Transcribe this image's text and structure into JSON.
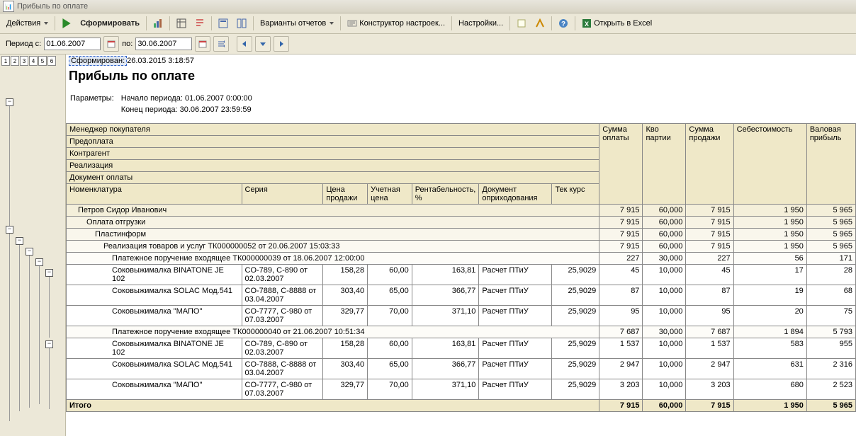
{
  "window_title": "Прибыль по оплате",
  "toolbar": {
    "actions": "Действия",
    "form": "Сформировать",
    "variants": "Варианты отчетов",
    "constructor": "Конструктор настроек...",
    "settings": "Настройки...",
    "open_excel": "Открыть в Excel"
  },
  "period": {
    "label_from": "Период с:",
    "from": "01.06.2007",
    "label_to": "по:",
    "to": "30.06.2007"
  },
  "meta": {
    "formed_prefix": "Сформирован:",
    "formed_at": "26.03.2015 3:18:57",
    "title": "Прибыль по оплате",
    "params_label": "Параметры:",
    "period_start": "Начало периода: 01.06.2007 0:00:00",
    "period_end": "Конец периода: 30.06.2007 23:59:59"
  },
  "headers": {
    "g0": "Менеджер покупателя",
    "g1": "Предоплата",
    "g2": "Контрагент",
    "g3": "Реализация",
    "g4": "Документ оплаты",
    "nomen": "Номенклатура",
    "series": "Серия",
    "price_sale": "Цена продажи",
    "price_acc": "Учетная цена",
    "profitab": "Рентабельность, %",
    "doc_in": "Документ оприходования",
    "rate": "Тек курс",
    "sum_pay": "Сумма оплаты",
    "qty": "Кво партии",
    "sum_sale": "Сумма продажи",
    "cost": "Себестоимость",
    "gross": "Валовая прибыль"
  },
  "groups": [
    {
      "lvl": 0,
      "label": "Петров Сидор Иванович",
      "s": "7 915",
      "q": "60,000",
      "ss": "7 915",
      "c": "1 950",
      "g": "5 965"
    },
    {
      "lvl": 1,
      "label": "Оплата отгрузки",
      "s": "7 915",
      "q": "60,000",
      "ss": "7 915",
      "c": "1 950",
      "g": "5 965"
    },
    {
      "lvl": 2,
      "label": "Пластинформ",
      "s": "7 915",
      "q": "60,000",
      "ss": "7 915",
      "c": "1 950",
      "g": "5 965"
    },
    {
      "lvl": 3,
      "label": "Реализация товаров и услуг ТК000000052 от 20.06.2007 15:03:33",
      "s": "7 915",
      "q": "60,000",
      "ss": "7 915",
      "c": "1 950",
      "g": "5 965"
    },
    {
      "lvl": 4,
      "label": "Платежное поручение входящее ТК000000039 от 18.06.2007 12:00:00",
      "s": "227",
      "q": "30,000",
      "ss": "227",
      "c": "56",
      "g": "171"
    }
  ],
  "rows1": [
    {
      "nomen": "Соковыжималка  BINATONE JE 102",
      "ser": "CO-789, C-890 от 02.03.2007",
      "ps": "158,28",
      "pa": "60,00",
      "r": "163,81",
      "doc": "Расчет ПТиУ",
      "rate": "25,9029",
      "s": "45",
      "q": "10,000",
      "ss": "45",
      "c": "17",
      "g": "28"
    },
    {
      "nomen": "Соковыжималка  SOLAC  Мод.541",
      "ser": "CO-7888, C-8888 от 03.04.2007",
      "ps": "303,40",
      "pa": "65,00",
      "r": "366,77",
      "doc": "Расчет ПТиУ",
      "rate": "25,9029",
      "s": "87",
      "q": "10,000",
      "ss": "87",
      "c": "19",
      "g": "68"
    },
    {
      "nomen": "Соковыжималка \"МАПО\"",
      "ser": "CO-7777, C-980 от 07.03.2007",
      "ps": "329,77",
      "pa": "70,00",
      "r": "371,10",
      "doc": "Расчет ПТиУ",
      "rate": "25,9029",
      "s": "95",
      "q": "10,000",
      "ss": "95",
      "c": "20",
      "g": "75"
    }
  ],
  "group2": {
    "lvl": 4,
    "label": "Платежное поручение входящее ТК000000040 от 21.06.2007 10:51:34",
    "s": "7 687",
    "q": "30,000",
    "ss": "7 687",
    "c": "1 894",
    "g": "5 793"
  },
  "rows2": [
    {
      "nomen": "Соковыжималка  BINATONE JE 102",
      "ser": "CO-789, C-890 от 02.03.2007",
      "ps": "158,28",
      "pa": "60,00",
      "r": "163,81",
      "doc": "Расчет ПТиУ",
      "rate": "25,9029",
      "s": "1 537",
      "q": "10,000",
      "ss": "1 537",
      "c": "583",
      "g": "955"
    },
    {
      "nomen": "Соковыжималка  SOLAC  Мод.541",
      "ser": "CO-7888, C-8888 от 03.04.2007",
      "ps": "303,40",
      "pa": "65,00",
      "r": "366,77",
      "doc": "Расчет ПТиУ",
      "rate": "25,9029",
      "s": "2 947",
      "q": "10,000",
      "ss": "2 947",
      "c": "631",
      "g": "2 316"
    },
    {
      "nomen": "Соковыжималка \"МАПО\"",
      "ser": "CO-7777, C-980 от 07.03.2007",
      "ps": "329,77",
      "pa": "70,00",
      "r": "371,10",
      "doc": "Расчет ПТиУ",
      "rate": "25,9029",
      "s": "3 203",
      "q": "10,000",
      "ss": "3 203",
      "c": "680",
      "g": "2 523"
    }
  ],
  "total": {
    "label": "Итого",
    "s": "7 915",
    "q": "60,000",
    "ss": "7 915",
    "c": "1 950",
    "g": "5 965"
  }
}
